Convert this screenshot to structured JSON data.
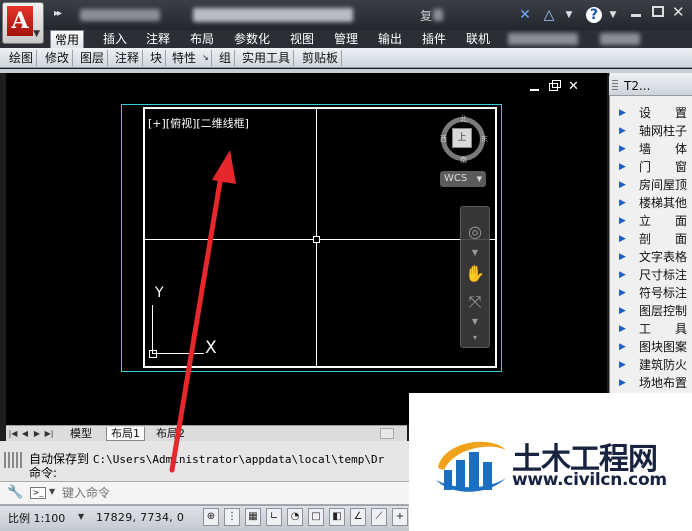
{
  "ribbon": {
    "tabs": [
      "常用",
      "插入",
      "注释",
      "布局",
      "参数化",
      "视图",
      "管理",
      "输出",
      "插件",
      "联机"
    ],
    "active_tab": "常用"
  },
  "panels": [
    "绘图",
    "修改",
    "图层",
    "注释",
    "块",
    "特性",
    "组",
    "实用工具",
    "剪贴板"
  ],
  "title_bar": {
    "partial_char": "复"
  },
  "viewport": {
    "label": "[+][俯视][二维线框]",
    "viewcube": {
      "face": "上",
      "north": "北",
      "south": "南",
      "east": "东",
      "west": "西"
    },
    "wcs_label": "WCS",
    "ucs_x": "X",
    "ucs_y": "Y"
  },
  "layout_tabs": [
    "模型",
    "布局1",
    "布局2"
  ],
  "command": {
    "history_prefix": "自动保存到 ",
    "history_path": "C:\\Users\\Administrator\\appdata\\local\\temp\\Dr",
    "prompt": "命令:",
    "input_placeholder": "键入命令"
  },
  "status_bar": {
    "scale": "比例 1:100",
    "coordinates": "17829, 7734, 0"
  },
  "tool_palette": {
    "title": "T2...",
    "items": [
      "设置",
      "轴网柱子",
      "墙体",
      "门窗",
      "房间屋顶",
      "楼梯其他",
      "立面",
      "剖面",
      "文字表格",
      "尺寸标注",
      "符号标注",
      "图层控制",
      "工具",
      "图块图案",
      "建筑防火",
      "场地布置"
    ]
  },
  "watermark": {
    "title": "土木工程网",
    "url": "www.civilcn.com"
  },
  "colors": {
    "accent_cyan": "#2fd0d6",
    "arrow_red": "#e8262d",
    "canvas": "#000000"
  }
}
